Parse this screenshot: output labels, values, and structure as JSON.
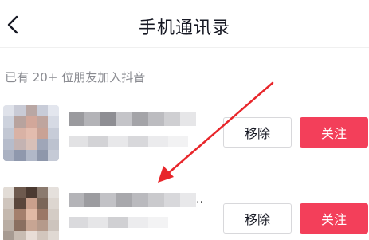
{
  "header": {
    "title": "手机通讯录",
    "back_icon": "chevron-left-icon"
  },
  "section": {
    "note": "已有 20+ 位朋友加入抖音"
  },
  "contacts": [
    {
      "remove_label": "移除",
      "follow_label": "关注"
    },
    {
      "remove_label": "移除",
      "follow_label": "关注",
      "name_suffix": ".."
    }
  ],
  "colors": {
    "follow_button": "#f33f5a",
    "annotation_arrow": "#e8262b",
    "secondary_text": "#8a8b91"
  }
}
